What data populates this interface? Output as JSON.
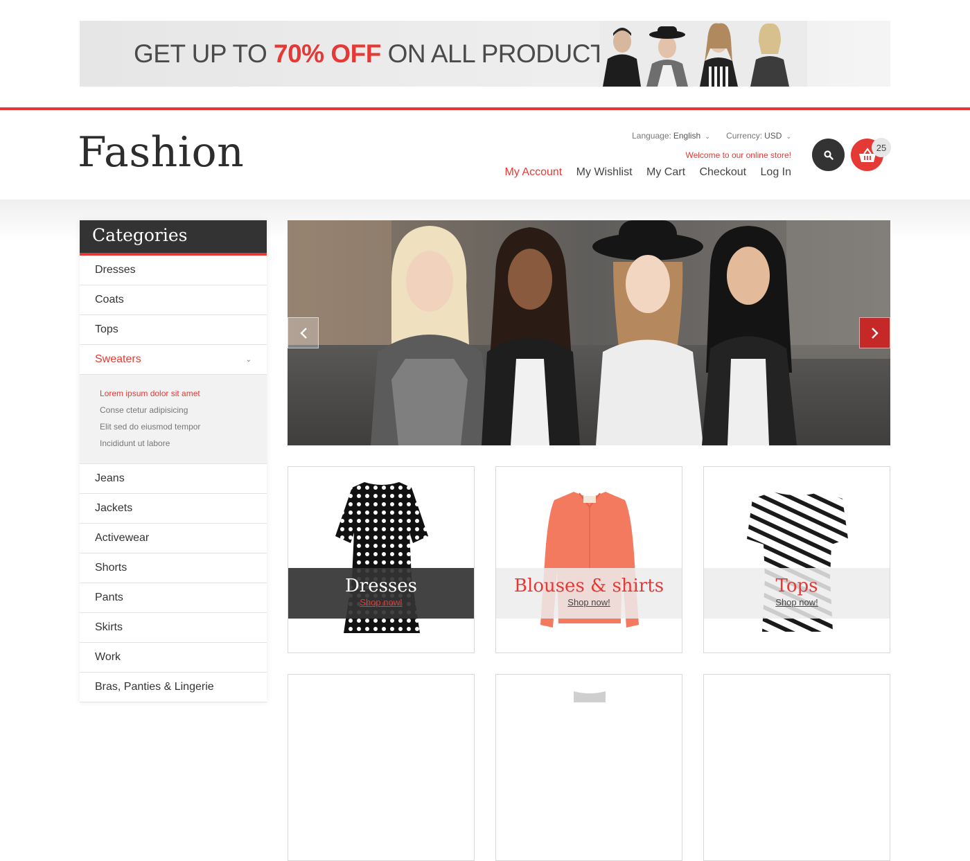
{
  "promo": {
    "text_before": "GET UP TO ",
    "highlight": "70% OFF",
    "text_after": " ON ALL PRODUCTS"
  },
  "header": {
    "logo": "Fashion",
    "language_label": "Language:",
    "language_value": "English",
    "currency_label": "Currency:",
    "currency_value": "USD",
    "welcome": "Welcome to our online store!",
    "nav": [
      "My Account",
      "My Wishlist",
      "My Cart",
      "Checkout",
      "Log In"
    ],
    "cart_count": "25"
  },
  "sidebar": {
    "title": "Categories",
    "items_top": [
      "Dresses",
      "Coats",
      "Tops",
      "Sweaters"
    ],
    "subitems": [
      "Lorem ipsum dolor sit amet",
      "Conse ctetur adipisicing",
      "Elit sed do eiusmod tempor",
      "Incididunt ut labore"
    ],
    "items_bottom": [
      "Jeans",
      "Jackets",
      "Activewear",
      "Shorts",
      "Pants",
      "Skirts",
      "Work",
      "Bras, Panties & Lingerie"
    ]
  },
  "tiles": [
    {
      "title": "Dresses",
      "link": "Shop now!"
    },
    {
      "title": "Blouses & shirts",
      "link": "Shop now!"
    },
    {
      "title": "Tops",
      "link": "Shop now!"
    }
  ],
  "colors": {
    "accent": "#e53935",
    "dark": "#333333"
  },
  "icons": {
    "search": "search-icon",
    "cart": "basket-icon",
    "prev": "chevron-left-icon",
    "next": "chevron-right-icon"
  }
}
